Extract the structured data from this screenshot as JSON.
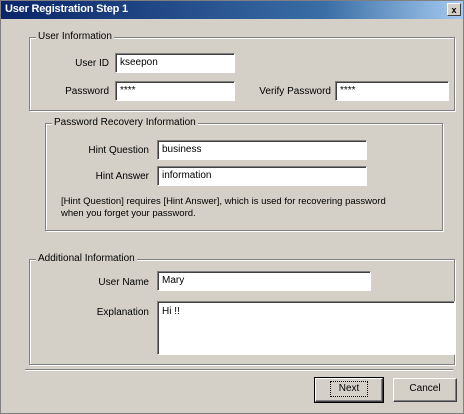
{
  "window": {
    "title": "User Registration Step 1",
    "close_glyph": "x"
  },
  "user_info": {
    "legend": "User Information",
    "user_id_label": "User ID",
    "user_id_value": "kseepon",
    "password_label": "Password",
    "password_value": "****",
    "verify_password_label": "Verify Password",
    "verify_password_value": "****"
  },
  "recovery": {
    "legend": "Password Recovery Information",
    "hint_question_label": "Hint Question",
    "hint_question_value": "business",
    "hint_answer_label": "Hint Answer",
    "hint_answer_value": "information",
    "note_line1": "[Hint Question] requires [Hint Answer],  which is used for recovering password",
    "note_line2": "when you forget your password."
  },
  "additional": {
    "legend": "Additional Information",
    "user_name_label": "User Name",
    "user_name_value": "Mary",
    "explanation_label": "Explanation",
    "explanation_value": "Hi !!"
  },
  "buttons": {
    "next_label": "Next",
    "cancel_label": "Cancel"
  }
}
